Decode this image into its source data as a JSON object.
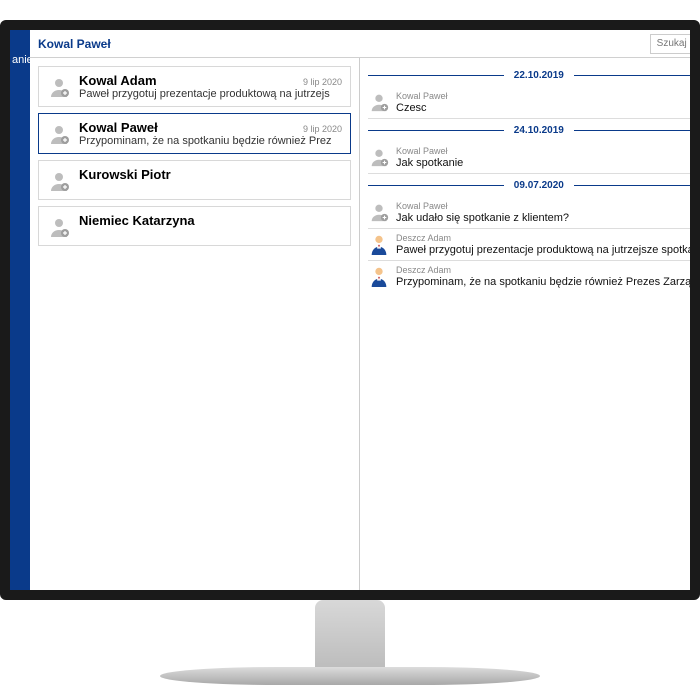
{
  "sidebar": {
    "label": "anie"
  },
  "header": {
    "title": "Kowal Paweł",
    "search_placeholder": "Szukaj"
  },
  "contacts": [
    {
      "name": "Kowal Adam",
      "date": "9 lip 2020",
      "preview": "Paweł przygotuj prezentacje produktową na jutrzejs",
      "selected": false
    },
    {
      "name": "Kowal Paweł",
      "date": "9 lip 2020",
      "preview": "Przypominam, że na spotkaniu będzie również Prez",
      "selected": true
    },
    {
      "name": "Kurowski Piotr",
      "date": "",
      "preview": "",
      "selected": false
    },
    {
      "name": "Niemiec Katarzyna",
      "date": "",
      "preview": "",
      "selected": false
    }
  ],
  "conversation": {
    "groups": [
      {
        "date": "22.10.2019",
        "messages": [
          {
            "author": "Kowal Paweł",
            "text": "Czesc",
            "avatar": "gray"
          }
        ]
      },
      {
        "date": "24.10.2019",
        "messages": [
          {
            "author": "Kowal Paweł",
            "text": "Jak spotkanie",
            "avatar": "gray"
          }
        ]
      },
      {
        "date": "09.07.2020",
        "messages": [
          {
            "author": "Kowal Paweł",
            "text": "Jak udało się spotkanie z klientem?",
            "avatar": "gray"
          },
          {
            "author": "Deszcz Adam",
            "text": "Paweł przygotuj prezentacje produktową na jutrzejsze spotkani",
            "avatar": "person"
          },
          {
            "author": "Deszcz Adam",
            "text": "Przypominam, że na spotkaniu będzie również Prezes Zarządu!!",
            "avatar": "person"
          }
        ]
      }
    ]
  }
}
